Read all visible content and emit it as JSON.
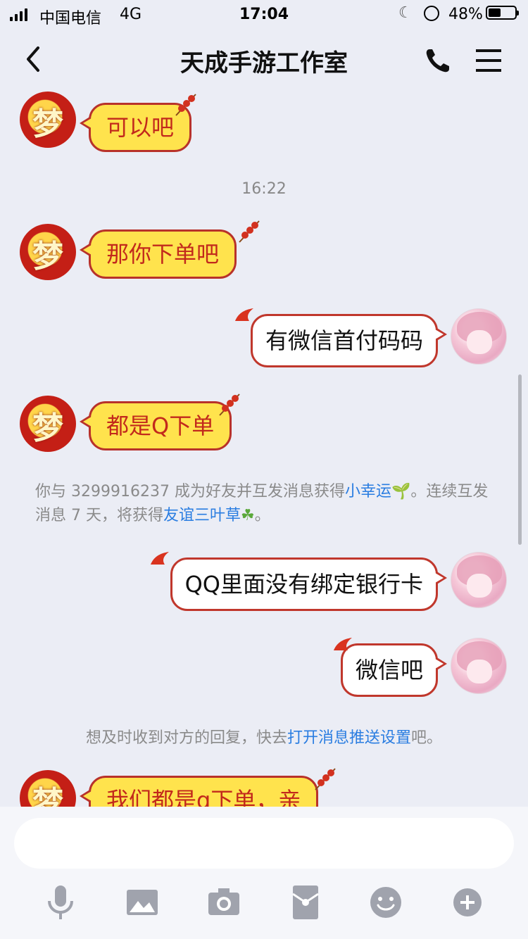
{
  "status_bar": {
    "carrier": "中国电信",
    "network": "4G",
    "time": "17:04",
    "battery": "48%",
    "battery_level": 0.48
  },
  "nav": {
    "title": "天成手游工作室",
    "back_icon": "chevron-left-icon",
    "call_icon": "phone-icon",
    "menu_icon": "menu-icon"
  },
  "colors": {
    "yellow_bubble": "#ffe34d",
    "bubble_border": "#b8322a",
    "link": "#2a7de1",
    "background": "#ebedf5"
  },
  "messages": [
    {
      "side": "left",
      "text": "可以吧"
    },
    {
      "side": "time",
      "text": "16:22"
    },
    {
      "side": "left",
      "text": "那你下单吧"
    },
    {
      "side": "right",
      "text": "有微信首付码码"
    },
    {
      "side": "left",
      "text": "都是Q下单"
    },
    {
      "side": "right",
      "text": "QQ里面没有绑定银行卡"
    },
    {
      "side": "right",
      "text": "微信吧"
    },
    {
      "side": "left",
      "text": "我们都是q下单，亲"
    }
  ],
  "system_notes": {
    "friend": {
      "part1": "你与 3299916237 成为好友并互发消息获得",
      "link1": "小幸运",
      "part2": "。连续互发消息 7 天，将获得",
      "link2": "友谊三叶草",
      "part3": "。"
    },
    "push": {
      "part1": "想及时收到对方的回复，快去",
      "link": "打开消息推送设置",
      "part2": "吧。"
    }
  },
  "toolbar": [
    "microphone-icon",
    "image-icon",
    "camera-icon",
    "red-packet-icon",
    "emoji-icon",
    "plus-icon"
  ]
}
